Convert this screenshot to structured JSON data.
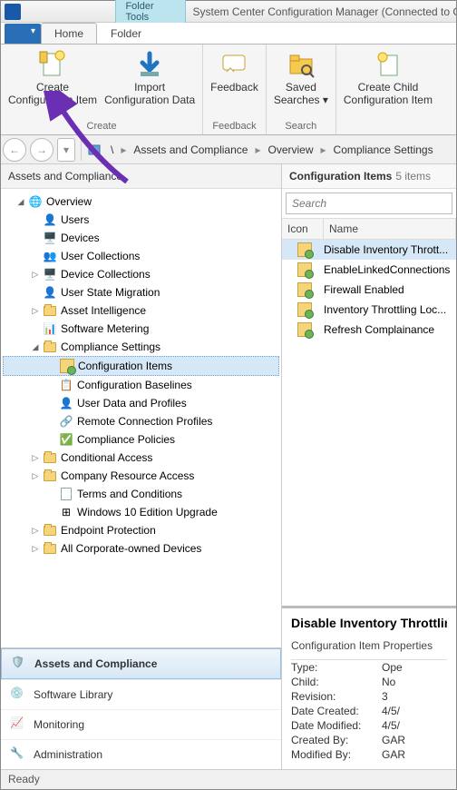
{
  "title": "System Center Configuration Manager (Connected to CBT)",
  "folder_tools_label": "Folder Tools",
  "tabs": {
    "home": "Home",
    "folder": "Folder"
  },
  "ribbon": {
    "create_group": "Create",
    "feedback_group": "Feedback",
    "search_group": "Search",
    "create_ci": "Create\nConfiguration Item",
    "import_cd": "Import\nConfiguration Data",
    "feedback": "Feedback",
    "saved_searches": "Saved\nSearches ▾",
    "create_child": "Create Child\nConfiguration Item"
  },
  "breadcrumb": [
    "\\",
    "Assets and Compliance",
    "Overview",
    "Compliance Settings"
  ],
  "left_header": "Assets and Compliance",
  "tree": {
    "overview": "Overview",
    "users": "Users",
    "devices": "Devices",
    "user_collections": "User Collections",
    "device_collections": "Device Collections",
    "user_state_migration": "User State Migration",
    "asset_intelligence": "Asset Intelligence",
    "software_metering": "Software Metering",
    "compliance_settings": "Compliance Settings",
    "configuration_items": "Configuration Items",
    "configuration_baselines": "Configuration Baselines",
    "user_data_profiles": "User Data and Profiles",
    "remote_connection_profiles": "Remote Connection Profiles",
    "compliance_policies": "Compliance Policies",
    "conditional_access": "Conditional Access",
    "company_resource_access": "Company Resource Access",
    "terms_conditions": "Terms and Conditions",
    "win10_edition": "Windows 10 Edition Upgrade",
    "endpoint_protection": "Endpoint Protection",
    "all_corp_devices": "All Corporate-owned Devices"
  },
  "wunderbar": {
    "assets": "Assets and Compliance",
    "software": "Software Library",
    "monitoring": "Monitoring",
    "admin": "Administration"
  },
  "list": {
    "title": "Configuration Items",
    "count": "5 items",
    "search_placeholder": "Search",
    "col_icon": "Icon",
    "col_name": "Name",
    "items": [
      "Disable Inventory Thrott...",
      "EnableLinkedConnections",
      "Firewall Enabled",
      "Inventory Throttling Loc...",
      "Refresh Complainance"
    ]
  },
  "details": {
    "title": "Disable Inventory Throttling L",
    "subtitle": "Configuration Item Properties",
    "props": [
      {
        "k": "Type:",
        "v": "Ope"
      },
      {
        "k": "Child:",
        "v": "No"
      },
      {
        "k": "Revision:",
        "v": "3"
      },
      {
        "k": "Date Created:",
        "v": "4/5/"
      },
      {
        "k": "Date Modified:",
        "v": "4/5/"
      },
      {
        "k": "Created By:",
        "v": "GAR"
      },
      {
        "k": "Modified By:",
        "v": "GAR"
      }
    ]
  },
  "status": "Ready"
}
